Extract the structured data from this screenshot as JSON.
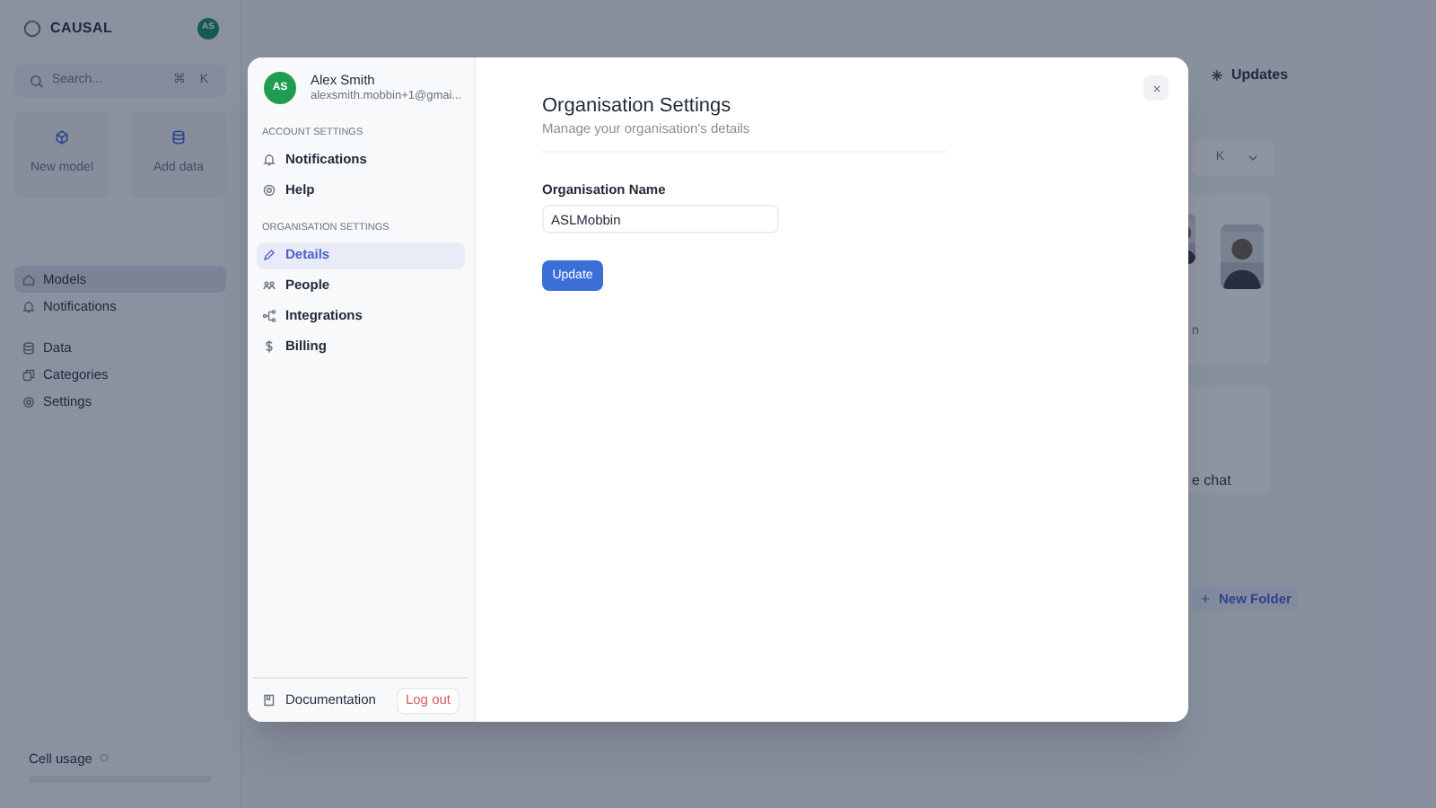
{
  "app": {
    "logo": "CAUSAL",
    "avatar": "AS",
    "search": {
      "placeholder": "Search...",
      "keys": [
        "⌘",
        "K"
      ]
    },
    "quick_actions": [
      {
        "label": "New model"
      },
      {
        "label": "Add data"
      }
    ],
    "nav_groups": [
      {
        "items": [
          {
            "label": "Models",
            "selected": true
          },
          {
            "label": "Notifications",
            "selected": false
          }
        ]
      },
      {
        "items": [
          {
            "label": "Data",
            "selected": false
          },
          {
            "label": "Categories",
            "selected": false
          },
          {
            "label": "Settings",
            "selected": false
          }
        ]
      }
    ],
    "cell_usage": "Cell usage"
  },
  "main": {
    "updates_button": "Updates",
    "filter_key": "K",
    "partial_texts": [
      "n",
      "e chat"
    ],
    "new_folder_button": "New Folder"
  },
  "modal": {
    "user": {
      "initials": "AS",
      "name": "Alex Smith",
      "email": "alexsmith.mobbin+1@gmai..."
    },
    "sections": [
      {
        "heading": "ACCOUNT SETTINGS",
        "items": [
          {
            "label": "Notifications",
            "selected": false
          },
          {
            "label": "Help",
            "selected": false
          }
        ]
      },
      {
        "heading": "ORGANISATION SETTINGS",
        "items": [
          {
            "label": "Details",
            "selected": true
          },
          {
            "label": "People",
            "selected": false
          },
          {
            "label": "Integrations",
            "selected": false
          },
          {
            "label": "Billing",
            "selected": false
          }
        ]
      }
    ],
    "footer": {
      "documentation": "Documentation",
      "logout": "Log out"
    },
    "title": "Organisation Settings",
    "subtitle": "Manage your organisation's details",
    "field": {
      "label": "Organisation Name",
      "value": "ASLMobbin"
    },
    "submit": "Update"
  }
}
